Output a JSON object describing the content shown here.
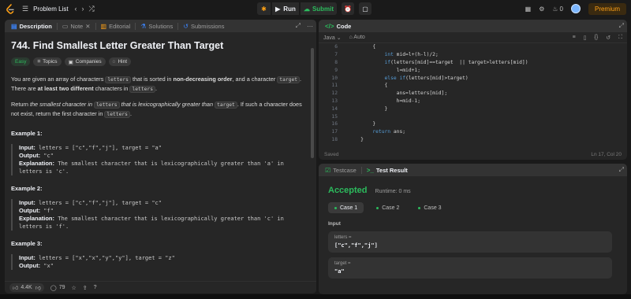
{
  "topbar": {
    "problem_list_label": "Problem List",
    "run_label": "Run",
    "submit_label": "Submit",
    "streak_count": "0",
    "premium_label": "Premium"
  },
  "colors": {
    "accent": "#ffa116",
    "success": "#2cbb5d",
    "background": "#1a1a1a",
    "panel": "#262626"
  },
  "left_tabs": [
    {
      "label": "Description",
      "icon": "description-icon"
    },
    {
      "label": "Note",
      "icon": "note-icon"
    },
    {
      "label": "Editorial",
      "icon": "editorial-icon"
    },
    {
      "label": "Solutions",
      "icon": "solutions-icon"
    },
    {
      "label": "Submissions",
      "icon": "submissions-icon"
    }
  ],
  "problem": {
    "title": "744. Find Smallest Letter Greater Than Target",
    "difficulty": "Easy",
    "badges": [
      "Topics",
      "Companies",
      "Hint"
    ],
    "p1_a": "You are given an array of characters ",
    "p1_code1": "letters",
    "p1_b": " that is sorted in ",
    "p1_bold1": "non-decreasing order",
    "p1_c": ", and a character ",
    "p1_code2": "target",
    "p1_d": ". There are ",
    "p1_bold2": "at least two different",
    "p1_e": " characters in ",
    "p1_code3": "letters",
    "p1_f": ".",
    "p2_a": "Return ",
    "p2_it1": "the smallest character in ",
    "p2_code1": "letters",
    "p2_it2": " that is lexicographically greater than ",
    "p2_code2": "target",
    "p2_b": ". If such a character does not exist, return the first character in ",
    "p2_code3": "letters",
    "p2_c": ".",
    "examples": [
      {
        "title": "Example 1:",
        "input_label": "Input:",
        "input": " letters = [\"c\",\"f\",\"j\"], target = \"a\"",
        "output_label": "Output:",
        "output": " \"c\"",
        "expl_label": "Explanation:",
        "expl": " The smallest character that is lexicographically greater than 'a' in letters is 'c'."
      },
      {
        "title": "Example 2:",
        "input_label": "Input:",
        "input": " letters = [\"c\",\"f\",\"j\"], target = \"c\"",
        "output_label": "Output:",
        "output": " \"f\"",
        "expl_label": "Explanation:",
        "expl": " The smallest character that is lexicographically greater than 'c' in letters is 'f'."
      },
      {
        "title": "Example 3:",
        "input_label": "Input:",
        "input": " letters = [\"x\",\"x\",\"y\",\"y\"], target = \"z\"",
        "output_label": "Output:",
        "output": " \"x\""
      }
    ]
  },
  "footer": {
    "likes": "4.4K",
    "comments": "79"
  },
  "code_panel": {
    "tab_label": "Code",
    "language": "Java",
    "mode": "Auto",
    "status_left": "Saved",
    "status_right": "Ln 17, Col 20",
    "lines": [
      {
        "n": "6",
        "t": "        {"
      },
      {
        "n": "7",
        "t": "            int mid=l+(h-l)/2;"
      },
      {
        "n": "8",
        "t": "            if(letters[mid]==target  || target>letters[mid])"
      },
      {
        "n": "9",
        "t": "                l=mid+1;"
      },
      {
        "n": "10",
        "t": "            else if(letters[mid]>target)"
      },
      {
        "n": "11",
        "t": "            {"
      },
      {
        "n": "12",
        "t": "                ans=letters[mid];"
      },
      {
        "n": "13",
        "t": "                h=mid-1;"
      },
      {
        "n": "14",
        "t": "            }"
      },
      {
        "n": "15",
        "t": ""
      },
      {
        "n": "16",
        "t": "        }"
      },
      {
        "n": "17",
        "t": "        return ans;"
      },
      {
        "n": "18",
        "t": "    }"
      }
    ]
  },
  "result_panel": {
    "testcase_label": "Testcase",
    "result_label": "Test Result",
    "status": "Accepted",
    "runtime": "Runtime: 0 ms",
    "cases": [
      "Case 1",
      "Case 2",
      "Case 3"
    ],
    "input_label": "Input",
    "inputs": [
      {
        "name": "letters =",
        "value": "[\"c\",\"f\",\"j\"]"
      },
      {
        "name": "target =",
        "value": "\"a\""
      }
    ]
  }
}
